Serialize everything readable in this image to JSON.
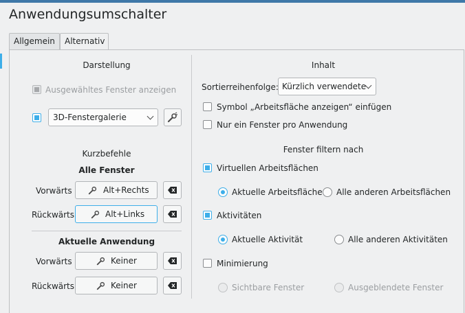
{
  "window": {
    "title": "Anwendungsumschalter"
  },
  "tabs": [
    {
      "label": "Allgemein",
      "active": false
    },
    {
      "label": "Alternativ",
      "active": true
    }
  ],
  "left": {
    "darstellung": {
      "heading": "Darstellung",
      "show_selected_window": {
        "label": "Ausgewähltes Fenster anzeigen",
        "checked": true,
        "enabled": false
      },
      "layout_enabled": true,
      "layout_value": "3D-Fenstergalerie"
    },
    "shortcuts": {
      "heading": "Kurzbefehle",
      "all_windows": {
        "heading": "Alle Fenster",
        "forward_label": "Vorwärts",
        "forward_value": "Alt+Rechts",
        "backward_label": "Rückwärts",
        "backward_value": "Alt+Links"
      },
      "current_app": {
        "heading": "Aktuelle Anwendung",
        "forward_label": "Vorwärts",
        "forward_value": "Keiner",
        "backward_label": "Rückwärts",
        "backward_value": "Keiner"
      }
    }
  },
  "right": {
    "content": {
      "heading": "Inhalt",
      "sort_label": "Sortierreihenfolge:",
      "sort_value": "Kürzlich verwendete",
      "show_desktop": {
        "label": "Symbol „Arbeitsfläche anzeigen“ einfügen",
        "checked": false
      },
      "one_per_app": {
        "label": "Nur ein Fenster pro Anwendung",
        "checked": false
      }
    },
    "filter": {
      "heading": "Fenster filtern nach",
      "virtual_desktops": {
        "label": "Virtuellen Arbeitsflächen",
        "checked": true
      },
      "vd_current": "Aktuelle Arbeitsfläche",
      "vd_others": "Alle anderen Arbeitsflächen",
      "vd_selected": "current",
      "activities": {
        "label": "Aktivitäten",
        "checked": true
      },
      "act_current": "Aktuelle Aktivität",
      "act_others": "Alle anderen Aktivitäten",
      "act_selected": "current",
      "minimize": {
        "label": "Minimierung",
        "checked": false
      },
      "min_visible": "Sichtbare Fenster",
      "min_hidden": "Ausgeblendete Fenster"
    }
  },
  "colors": {
    "accent": "#3daee9",
    "background": "#eff0f1",
    "text": "#232627",
    "titlebar": "#3f78a8"
  },
  "icons": {
    "shortcut": "configure-shortcut-icon",
    "clear": "edit-clear-icon",
    "settings": "configure-icon",
    "dropdown": "chevron-down-icon"
  }
}
